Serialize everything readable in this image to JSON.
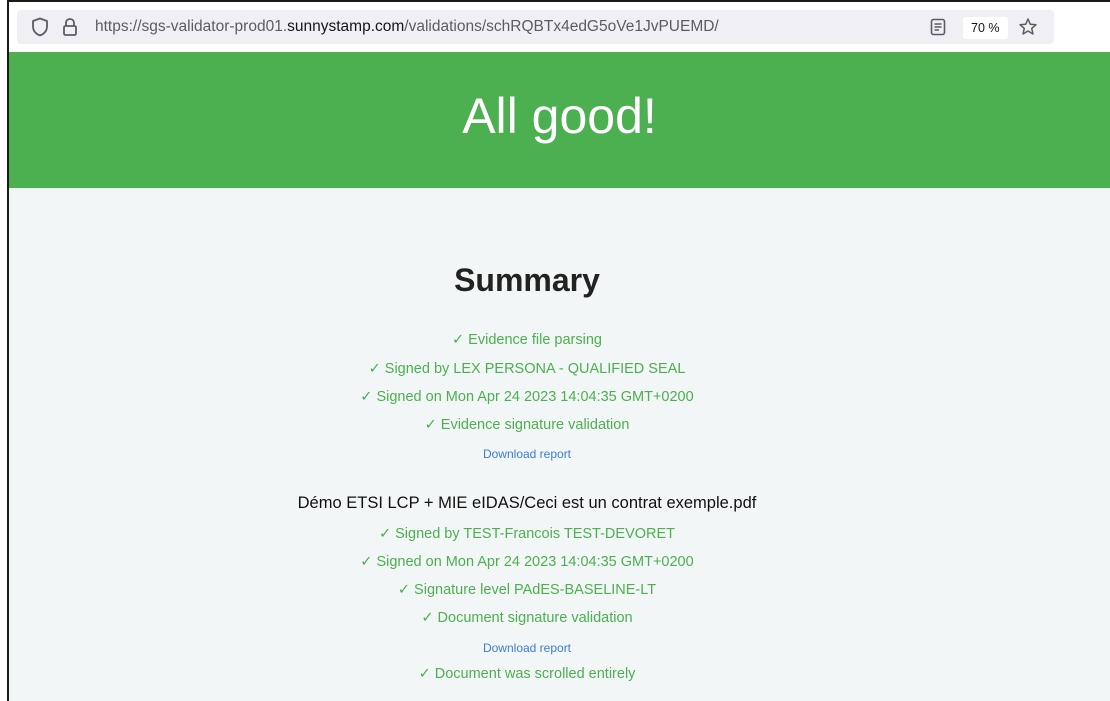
{
  "browser": {
    "url_prefix": "https://sgs-validator-prod01.",
    "url_host": "sunnystamp.com",
    "url_path": "/validations/schRQBTx4edG5oVe1JvPUEMD/",
    "zoom": "70 %",
    "icons": {
      "tracking_protection": "shield-icon",
      "security": "lock-icon",
      "reader_view": "reader-view-icon",
      "bookmark": "star-icon"
    }
  },
  "banner": {
    "title": "All good!",
    "color": "#4caf50"
  },
  "summary": {
    "title": "Summary",
    "checks": [
      "✓ Evidence file parsing",
      "✓ Signed by LEX PERSONA - QUALIFIED SEAL",
      "✓ Signed on Mon Apr 24 2023 14:04:35 GMT+0200",
      "✓ Evidence signature validation"
    ],
    "download_label": "Download report"
  },
  "document": {
    "title": "Démo ETSI LCP + MIE eIDAS/Ceci est un contrat exemple.pdf",
    "checks": [
      "✓ Signed by TEST-Francois TEST-DEVORET",
      "✓ Signed on Mon Apr 24 2023 14:04:35 GMT+0200",
      "✓ Signature level PAdES-BASELINE-LT",
      "✓ Document signature validation"
    ],
    "download_label": "Download report",
    "final_check": "✓ Document was scrolled entirely"
  },
  "colors": {
    "success": "#4caf50",
    "link": "#3b7dd8",
    "background": "#f3f6f6"
  }
}
